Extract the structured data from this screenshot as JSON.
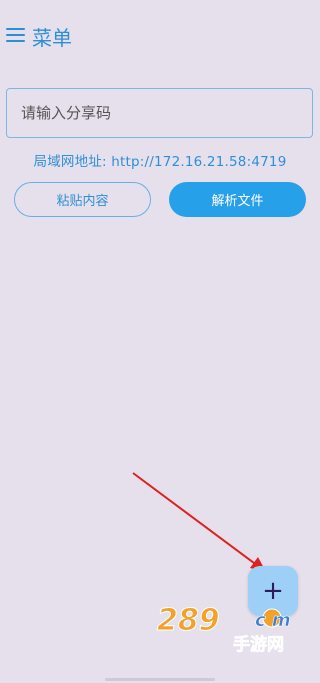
{
  "header": {
    "title": "菜单",
    "menu_icon": "hamburger-menu-icon"
  },
  "share_code": {
    "value": "",
    "placeholder": "请输入分享码"
  },
  "lan_address": "局域网地址: http://172.16.21.58:4719",
  "buttons": {
    "paste_label": "粘贴内容",
    "parse_label": "解析文件"
  },
  "fab": {
    "label": "+",
    "icon": "plus-icon"
  },
  "watermark": {
    "number": "289",
    "domain": "c m",
    "text": "手游网"
  },
  "colors": {
    "background": "#e6e0ec",
    "accent": "#2f8fd6",
    "primary_button": "#27a0ea",
    "fab": "#9ecff6",
    "arrow": "#e02020"
  }
}
